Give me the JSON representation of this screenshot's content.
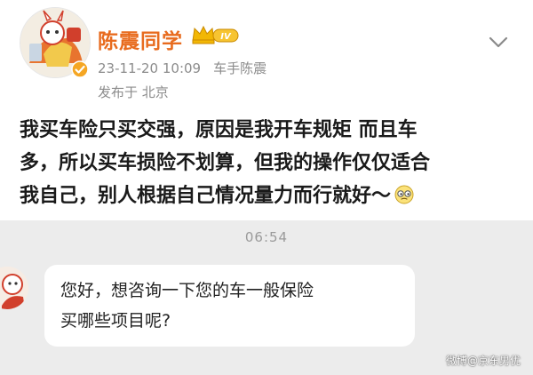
{
  "post": {
    "author_name": "陈震同学",
    "level_badge": "IV",
    "timestamp": "23-11-20 10:09",
    "source": "车手陈震",
    "posted_from": "发布于 北京",
    "body_lines": [
      "我买车险只买交强，原因是我开车规矩 而且车",
      "多，所以买车损险不划算，但我的操作仅仅适合",
      "我自己，别人根据自己情况量力而行就好～"
    ],
    "more_icon": "more-options-icon",
    "emoji_icon": "smirk-emoji-icon"
  },
  "chat": {
    "time": "06:54",
    "message_lines": [
      "您好，想咨询一下您的车一般保险",
      "买哪些项目呢?"
    ]
  },
  "watermark": "微博@京东男优",
  "colors": {
    "name": "#e86b1e",
    "meta": "#8c8c8c",
    "body": "#1a1a1a",
    "chat_bg": "#ececec",
    "bubble_bg": "#ffffff",
    "verify_badge": "#f5a623"
  }
}
